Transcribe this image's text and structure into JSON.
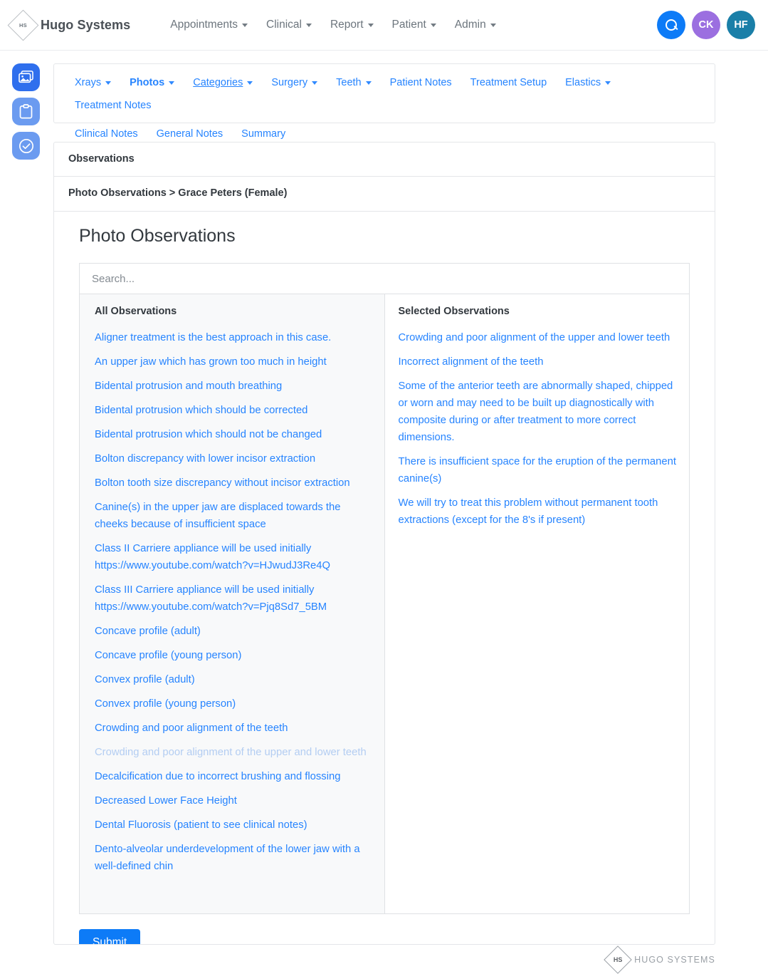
{
  "brand": {
    "mark": "HS",
    "name": "Hugo Systems"
  },
  "topnav": {
    "items": [
      {
        "label": "Appointments",
        "caret": true
      },
      {
        "label": "Clinical",
        "caret": true
      },
      {
        "label": "Report",
        "caret": true
      },
      {
        "label": "Patient",
        "caret": true
      },
      {
        "label": "Admin",
        "caret": true
      }
    ],
    "search_icon": "search-icon",
    "avatars": [
      {
        "initials": "CK",
        "color": "#9b6fe0"
      },
      {
        "initials": "HF",
        "color": "#1a7fa8"
      }
    ],
    "search_color": "#0d7bf7"
  },
  "rail": {
    "items": [
      {
        "icon": "photos-icon",
        "color": "#2f6fed",
        "active": true
      },
      {
        "icon": "clipboard-icon",
        "color": "#6b9bf0",
        "active": false
      },
      {
        "icon": "check-circle-icon",
        "color": "#6b9bf0",
        "active": false
      }
    ]
  },
  "tabs": [
    {
      "label": "Xrays",
      "caret": true,
      "bold": false,
      "underline": false
    },
    {
      "label": "Photos",
      "caret": true,
      "bold": true,
      "underline": false
    },
    {
      "label": "Categories",
      "caret": true,
      "bold": false,
      "underline": true
    },
    {
      "label": "Surgery",
      "caret": true,
      "bold": false,
      "underline": false
    },
    {
      "label": "Teeth",
      "caret": true,
      "bold": false,
      "underline": false
    },
    {
      "label": "Patient Notes",
      "caret": false,
      "bold": false,
      "underline": false
    },
    {
      "label": "Treatment Setup",
      "caret": false,
      "bold": false,
      "underline": false
    },
    {
      "label": "Elastics",
      "caret": true,
      "bold": false,
      "underline": false
    },
    {
      "label": "Treatment Notes",
      "caret": false,
      "bold": false,
      "underline": false
    },
    {
      "label": "Clinical Notes",
      "caret": false,
      "bold": false,
      "underline": false
    },
    {
      "label": "General Notes",
      "caret": false,
      "bold": false,
      "underline": false
    },
    {
      "label": "Summary",
      "caret": false,
      "bold": false,
      "underline": false
    }
  ],
  "panel": {
    "observations_header": "Observations",
    "breadcrumb": "Photo Observations > Grace Peters (Female)",
    "page_title": "Photo Observations",
    "search_placeholder": "Search...",
    "search_value": "",
    "submit_label": "Submit"
  },
  "all_observations": {
    "header": "All Observations",
    "items": [
      {
        "text": "Aligner treatment is the best approach in this case.",
        "disabled": false
      },
      {
        "text": "An upper jaw which has grown too much in height",
        "disabled": false
      },
      {
        "text": "Bidental protrusion and mouth breathing",
        "disabled": false
      },
      {
        "text": "Bidental protrusion which should be corrected",
        "disabled": false
      },
      {
        "text": "Bidental protrusion which should not be changed",
        "disabled": false
      },
      {
        "text": "Bolton discrepancy with lower incisor extraction",
        "disabled": false
      },
      {
        "text": "Bolton tooth size discrepancy without incisor extraction",
        "disabled": false
      },
      {
        "text": "Canine(s) in the upper jaw are displaced towards the cheeks because of insufficient space",
        "disabled": false
      },
      {
        "text": "Class II Carriere appliance will be used initially https://www.youtube.com/watch?v=HJwudJ3Re4Q",
        "disabled": false
      },
      {
        "text": "Class III Carriere appliance will be used initially https://www.youtube.com/watch?v=Pjq8Sd7_5BM",
        "disabled": false
      },
      {
        "text": "Concave profile (adult)",
        "disabled": false
      },
      {
        "text": "Concave profile (young person)",
        "disabled": false
      },
      {
        "text": "Convex profile (adult)",
        "disabled": false
      },
      {
        "text": "Convex profile (young person)",
        "disabled": false
      },
      {
        "text": "Crowding and poor alignment of the teeth",
        "disabled": false
      },
      {
        "text": "Crowding and poor alignment of the upper and lower teeth",
        "disabled": true
      },
      {
        "text": "Decalcification due to incorrect brushing and flossing",
        "disabled": false
      },
      {
        "text": "Decreased Lower Face Height",
        "disabled": false
      },
      {
        "text": "Dental Fluorosis (patient to see clinical notes)",
        "disabled": false
      },
      {
        "text": "Dento-alveolar underdevelopment of the lower jaw with a well-defined chin",
        "disabled": false
      }
    ]
  },
  "selected_observations": {
    "header": "Selected Observations",
    "items": [
      {
        "text": "Crowding and poor alignment of the upper and lower teeth"
      },
      {
        "text": "Incorrect alignment of the teeth"
      },
      {
        "text": "Some of the anterior teeth are abnormally shaped, chipped or worn and may need to be built up diagnostically with composite during or after treatment to more correct dimensions."
      },
      {
        "text": "There is insufficient space for the eruption of the permanent canine(s)"
      },
      {
        "text": "We will try to treat this problem without permanent tooth extractions (except for the 8's if present)"
      }
    ]
  },
  "footer": {
    "mark": "HS",
    "name": "HUGO SYSTEMS"
  }
}
